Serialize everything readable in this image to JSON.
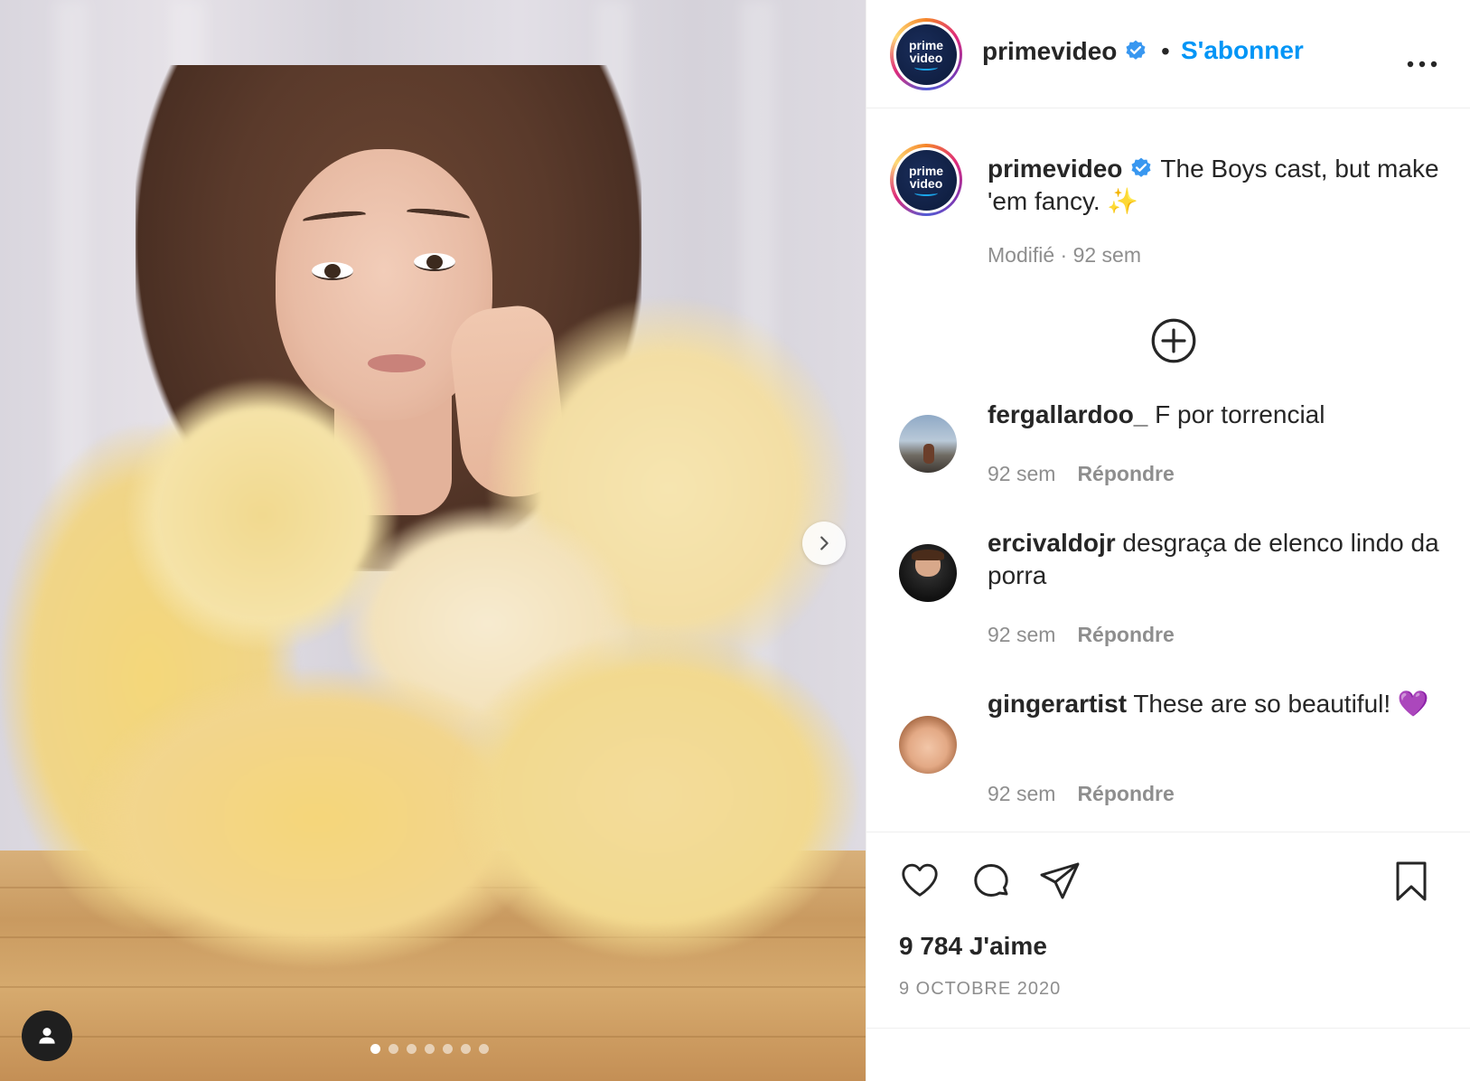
{
  "post": {
    "image_alt": "",
    "carousel": {
      "count": 7,
      "active_index": 0
    }
  },
  "header": {
    "username": "primevideo",
    "verified": true,
    "separator": "•",
    "follow_label": "S'abonner",
    "more_label": "•••",
    "avatar_logo_line1": "prime",
    "avatar_logo_line2": "video"
  },
  "caption": {
    "username": "primevideo",
    "text": "The Boys cast, but make 'em fancy. ✨",
    "meta": "Modifié · 92 sem"
  },
  "comments": [
    {
      "username": "fergallardoo_",
      "text": "F por torrencial",
      "time": "92 sem",
      "reply_label": "Répondre"
    },
    {
      "username": "ercivaldojr",
      "text": "desgraça de elenco lindo da porra",
      "time": "92 sem",
      "reply_label": "Répondre"
    },
    {
      "username": "gingerartist",
      "text": "These are so beautiful! 💜",
      "time": "92 sem",
      "reply_label": "Répondre"
    }
  ],
  "actions": {
    "likes": "9 784 J'aime",
    "date": "9 OCTOBRE 2020"
  },
  "colors": {
    "link_blue": "#0095f6",
    "text_dark": "#262626",
    "text_muted": "#8e8e8e",
    "verified_blue": "#3897f0",
    "border": "#efefef"
  }
}
